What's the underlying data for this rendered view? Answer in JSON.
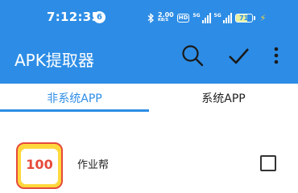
{
  "status_bar": {
    "time": "7:12:35",
    "notification_count": "6",
    "net_speed_value": "2.00",
    "net_speed_unit": "KB/S",
    "hd_label": "HD",
    "signal1_label": "5G",
    "signal2_label": "5G",
    "battery_percent": "71",
    "battery_level": 0.71
  },
  "app_bar": {
    "title": "APK提取器",
    "search_icon": "search-icon",
    "check_icon": "check-icon",
    "more_icon": "more-vert-icon"
  },
  "tabs": [
    {
      "label": "非系统APP",
      "selected": true
    },
    {
      "label": "系统APP",
      "selected": false
    }
  ],
  "apps": [
    {
      "icon_text": "100",
      "name": "作业帮",
      "checked": false
    }
  ],
  "colors": {
    "primary": "#2d8de6",
    "text": "#222222"
  }
}
